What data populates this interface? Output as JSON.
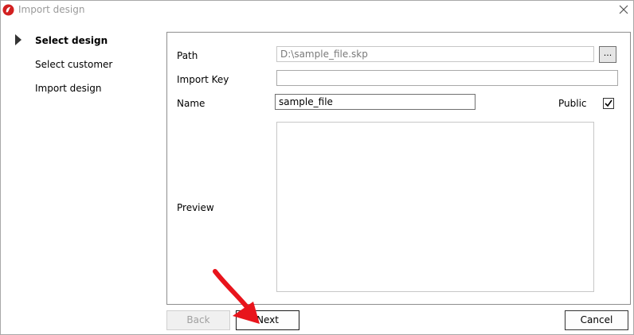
{
  "window": {
    "title": "Import design",
    "icon": "app-logo-icon",
    "close_icon": "close-icon"
  },
  "steps": [
    {
      "label": "Select design",
      "active": true
    },
    {
      "label": "Select customer",
      "active": false
    },
    {
      "label": "Import design",
      "active": false
    }
  ],
  "form": {
    "path_label": "Path",
    "path_value": "D:\\sample_file.skp",
    "browse_label": "...",
    "import_key_label": "Import Key",
    "import_key_value": "",
    "name_label": "Name",
    "name_value": "sample_file",
    "public_label": "Public",
    "public_checked": true,
    "preview_label": "Preview"
  },
  "buttons": {
    "back": "Back",
    "next": "Next",
    "cancel": "Cancel"
  },
  "colors": {
    "annotation_arrow": "#e8141c",
    "logo": "#d22020"
  }
}
